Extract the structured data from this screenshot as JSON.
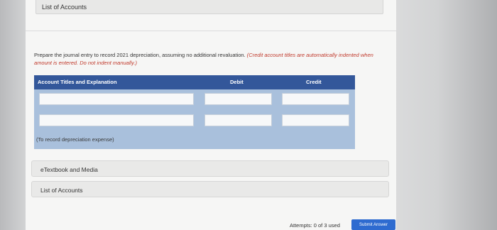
{
  "top_bar": {
    "label": "List of Accounts"
  },
  "instructions": {
    "text": "Prepare the journal entry to record 2021 depreciation, assuming no additional revaluation.",
    "note": "(Credit account titles are automatically indented when amount is entered. Do not indent manually.)"
  },
  "journal": {
    "headers": {
      "account": "Account Titles and Explanation",
      "debit": "Debit",
      "credit": "Credit"
    },
    "rows": [
      {
        "account": "",
        "debit": "",
        "credit": ""
      },
      {
        "account": "",
        "debit": "",
        "credit": ""
      }
    ],
    "memo": "(To record depreciation expense)"
  },
  "links": {
    "etextbook": "eTextbook and Media",
    "accounts": "List of Accounts"
  },
  "footer": {
    "attempts": "Attempts: 0 of 3 used",
    "submit": "Submit Answer"
  },
  "colors": {
    "header_blue": "#33579a",
    "table_blue": "#a9c0dc",
    "submit_blue": "#2e6bd0",
    "note_red": "#c0392b"
  }
}
